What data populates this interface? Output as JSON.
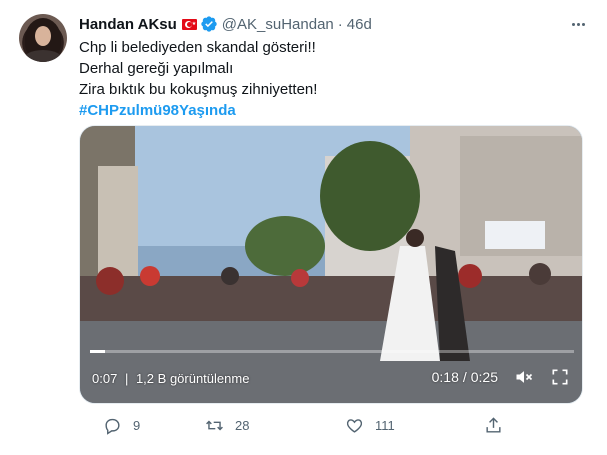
{
  "author": {
    "name": "Handan AKsu",
    "handle": "@AK_suHandan",
    "time": "46d",
    "separator": "·"
  },
  "tweet": {
    "lines": [
      "Chp li belediyeden skandal gösteri!!",
      "Derhal gereği yapılmalı",
      "Zira bıktık bu kokuşmuş zihniyetten!"
    ],
    "hashtag": "#CHPzulmü98Yaşında"
  },
  "video": {
    "progress_fraction": 0.03,
    "remaining": "0:07",
    "views_count": "1,2 B",
    "views_label": "görüntülenme",
    "elapsed": "0:18",
    "separator": "/",
    "total": "0:25"
  },
  "actions": {
    "replies": "9",
    "retweets": "28",
    "likes": "111"
  },
  "colors": {
    "accent": "#1d9bf0",
    "secondary_text": "#536471",
    "flag_red": "#e30a17"
  },
  "icons": {
    "verified": "verified-badge-icon",
    "more": "more-icon",
    "mute": "mute-icon",
    "fullscreen": "fullscreen-icon",
    "reply": "reply-icon",
    "retweet": "retweet-icon",
    "like": "like-icon",
    "share": "share-icon"
  }
}
